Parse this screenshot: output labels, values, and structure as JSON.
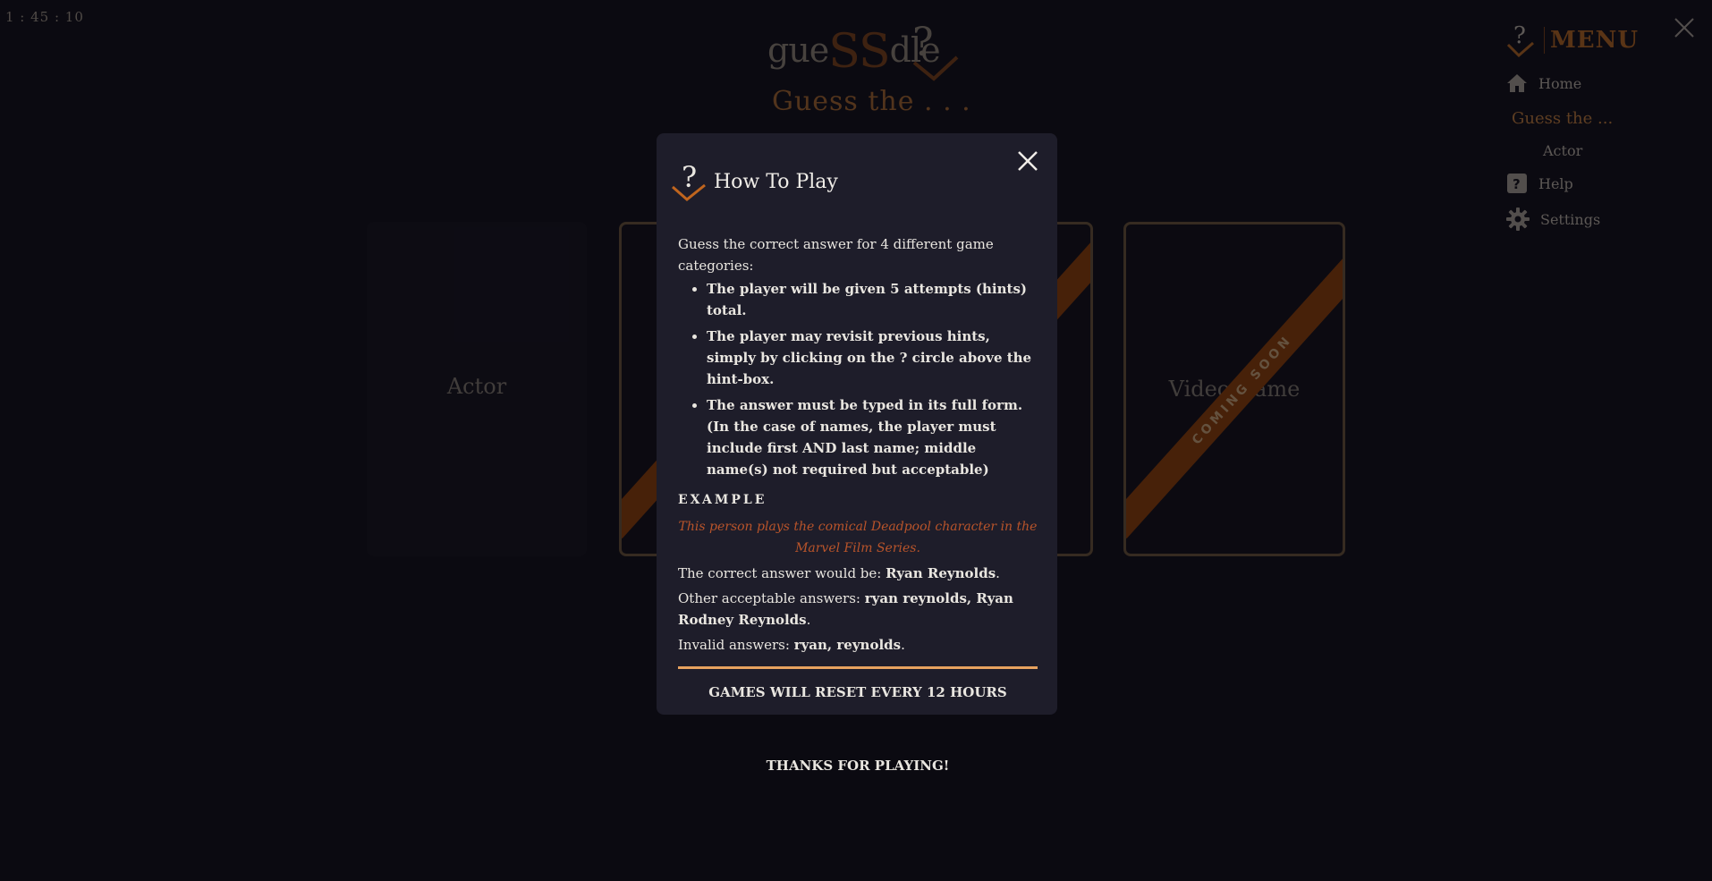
{
  "timer": "1 : 45 : 10",
  "header": {
    "logo_left": "gue",
    "logo_ss": "SS",
    "logo_right": "dle",
    "subtitle": "Guess the . . ."
  },
  "cards": [
    {
      "label": "Actor"
    },
    {
      "label": "",
      "ribbon": ""
    },
    {
      "label": "",
      "ribbon": ""
    },
    {
      "label": "Video Game",
      "ribbon": "COMING SOON"
    }
  ],
  "menu": {
    "title": "MENU",
    "items": [
      {
        "label": "Home",
        "icon": "home-icon"
      },
      {
        "label": "Guess the ..."
      },
      {
        "label": "Actor"
      },
      {
        "label": "Help",
        "icon": "help-icon"
      },
      {
        "label": "Settings",
        "icon": "gear-icon"
      }
    ]
  },
  "modal": {
    "title": "How To Play",
    "intro": "Guess the correct answer for 4 different game categories:",
    "rules": [
      "The player will be given 5 attempts (hints) total.",
      "The player may revisit previous hints, simply by clicking on the ? circle above the hint-box.",
      "The answer must be typed in its full form. (In the case of names, the player must include first AND last name; middle name(s) not required but acceptable)"
    ],
    "example_heading": "EXAMPLE",
    "example_text": "This person plays the comical Deadpool character in the Marvel Film Series.",
    "correct_prefix": "The correct answer would be: ",
    "correct_value": "Ryan Reynolds",
    "other_prefix": "Other acceptable answers: ",
    "other_value": "ryan reynolds, Ryan Rodney Reynolds",
    "invalid_prefix": "Invalid answers: ",
    "invalid_value": "ryan, reynolds",
    "reset_notice": "GAMES WILL RESET EVERY 12 HOURS",
    "thanks": "THANKS FOR PLAYING!"
  },
  "colors": {
    "accent": "#a56c36",
    "ribbon": "#7a3709",
    "modal_bg": "#1e1d2a",
    "rule": "#e7a25f"
  }
}
